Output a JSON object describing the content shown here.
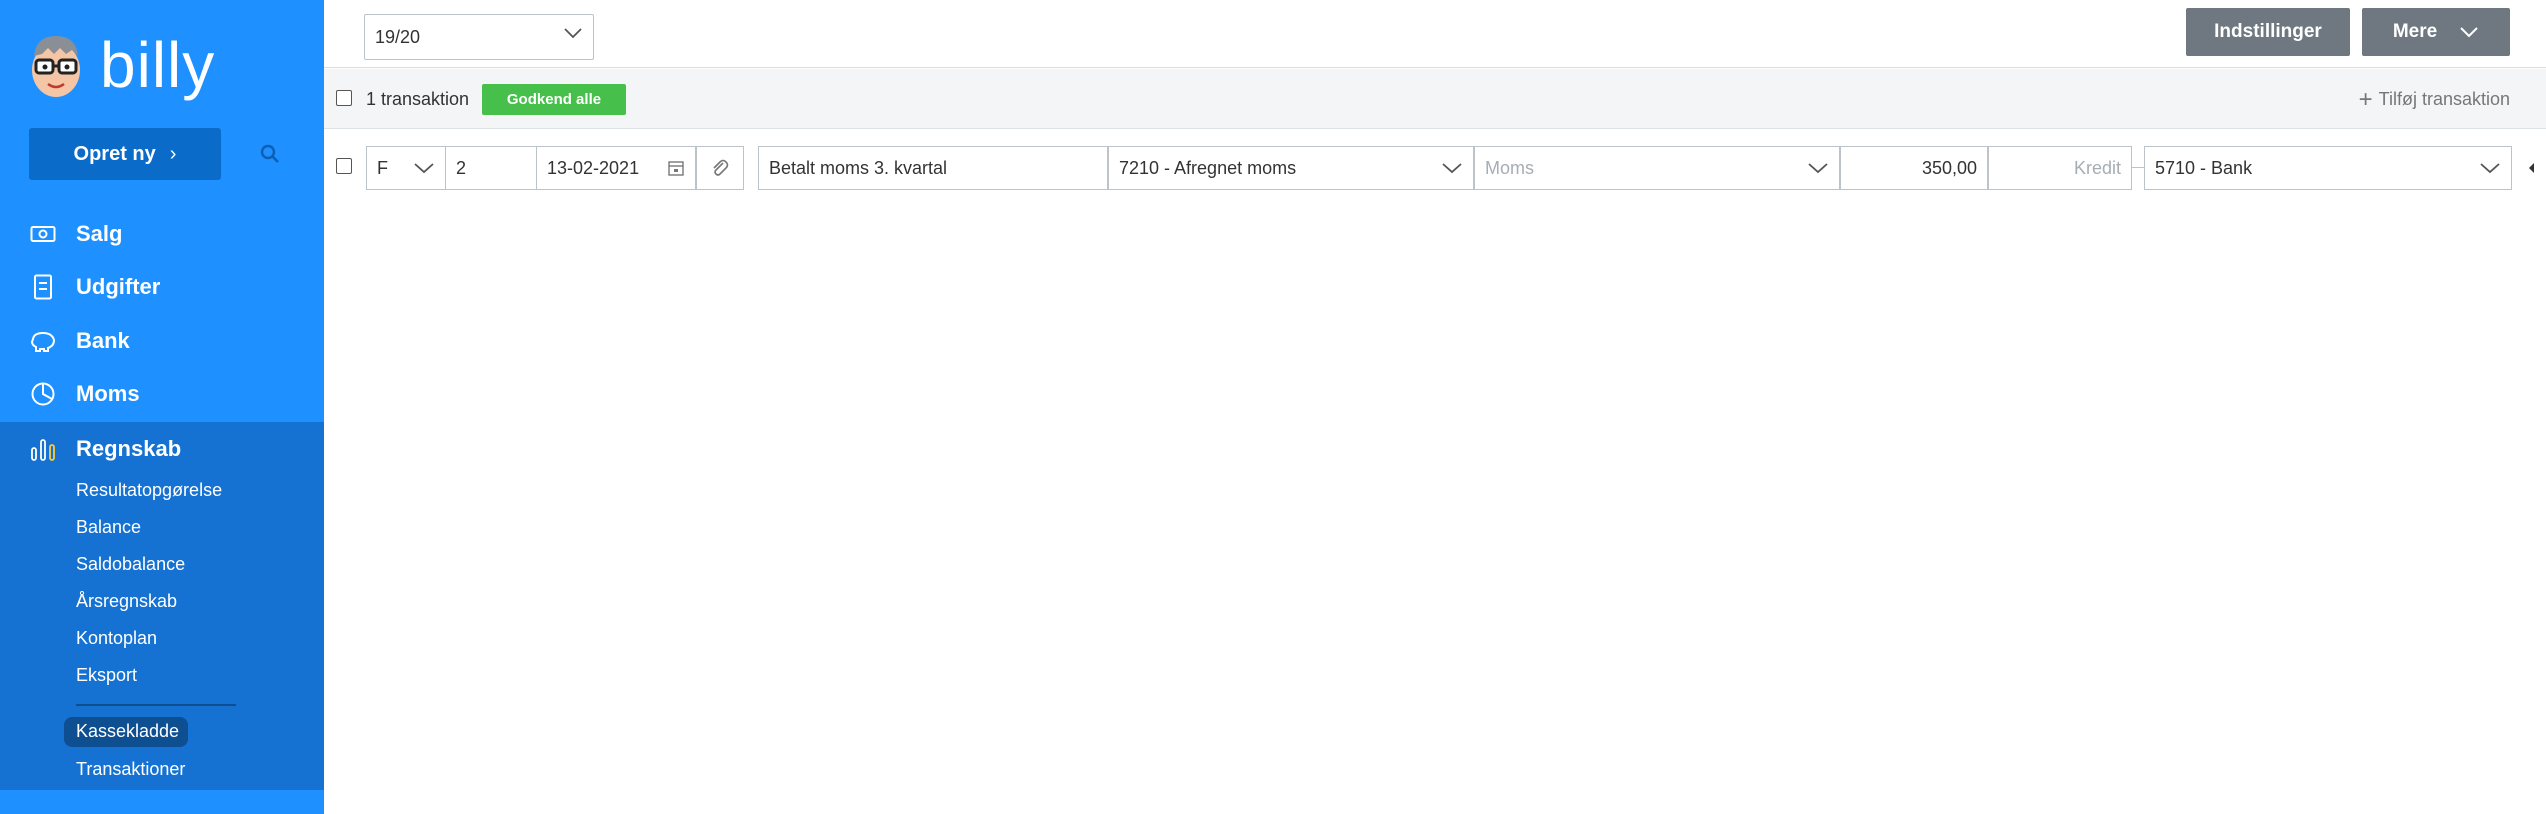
{
  "app": {
    "logo_text": "billy"
  },
  "sidebar": {
    "create_label": "Opret ny",
    "nav": [
      {
        "label": "Salg",
        "icon": "money-bill-icon"
      },
      {
        "label": "Udgifter",
        "icon": "receipt-icon"
      },
      {
        "label": "Bank",
        "icon": "piggy-bank-icon"
      },
      {
        "label": "Moms",
        "icon": "pie-chart-icon"
      },
      {
        "label": "Regnskab",
        "icon": "bar-chart-icon"
      }
    ],
    "sub": [
      "Resultatopgørelse",
      "Balance",
      "Saldobalance",
      "Årsregnskab",
      "Kontoplan",
      "Eksport",
      "Kassekladde",
      "Transaktioner"
    ]
  },
  "topbar": {
    "year": "19/20",
    "settings_label": "Indstillinger",
    "more_label": "Mere"
  },
  "toolbar": {
    "count_label": "1 transaktion",
    "approve_label": "Godkend alle",
    "add_label": "Tilføj transaktion"
  },
  "entry": {
    "type": "F",
    "number": "2",
    "date": "13-02-2021",
    "description": "Betalt moms 3. kvartal",
    "account": "7210 - Afregnet moms",
    "vat_placeholder": "Moms",
    "debit": "350,00",
    "credit_placeholder": "Kredit",
    "contra_account": "5710 - Bank"
  },
  "colors": {
    "sidebar": "#1e90ff",
    "sidebar_active": "#1572d3",
    "approve": "#46c04a",
    "gray_button": "#6f7880"
  }
}
